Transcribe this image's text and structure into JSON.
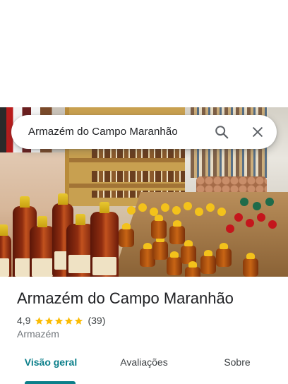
{
  "search": {
    "query": "Armazém do Campo Maranhão",
    "search_icon": "search-icon",
    "clear_icon": "close-icon"
  },
  "photo": {
    "description_icon": "store-photo"
  },
  "place": {
    "title": "Armazém do Campo Maranhão",
    "rating": "4,9",
    "stars": 5,
    "review_count": "(39)",
    "category": "Armazém"
  },
  "tabs": [
    {
      "label": "Visão geral",
      "active": true
    },
    {
      "label": "Avaliações",
      "active": false
    },
    {
      "label": "Sobre",
      "active": false
    }
  ],
  "colors": {
    "accent": "#0b7f8a",
    "star": "#fbbc04",
    "text_primary": "#202124",
    "text_secondary": "#70757a"
  }
}
